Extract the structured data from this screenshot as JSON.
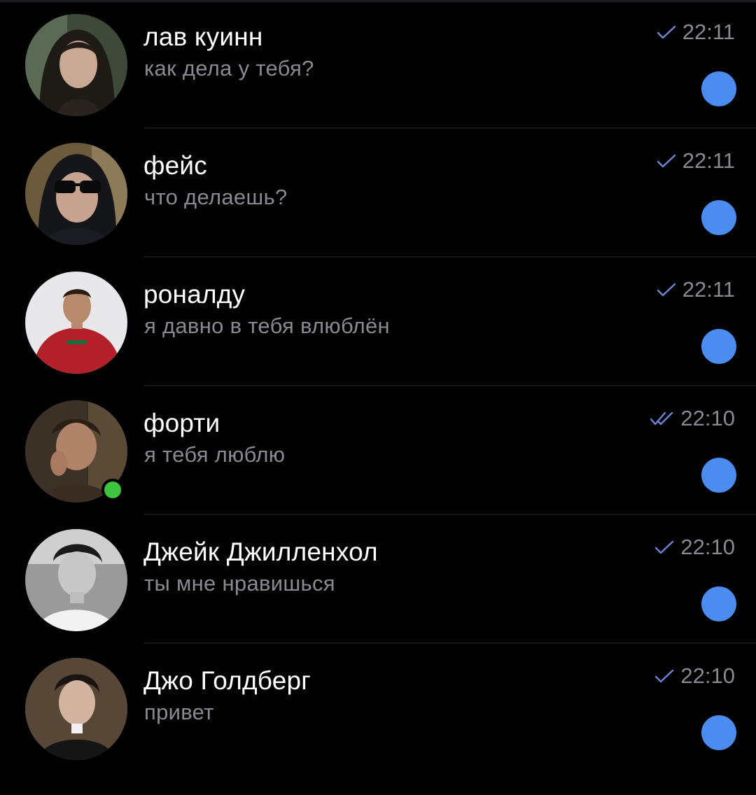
{
  "colors": {
    "background": "#000000",
    "name_text": "#ffffff",
    "secondary_text": "#8a8a8e",
    "read_check": "#6f86d6",
    "unread_dot": "#4a8cf0",
    "online_dot": "#3ec43e"
  },
  "chats": [
    {
      "name": "лав куинн",
      "preview": "как дела у тебя?",
      "time": "22:11",
      "status_icon": "single-check-icon",
      "unread": true,
      "online": false,
      "avatar_icon": "avatar-photo-woman"
    },
    {
      "name": "фейс",
      "preview": "что делаешь?",
      "time": "22:11",
      "status_icon": "single-check-icon",
      "unread": true,
      "online": false,
      "avatar_icon": "avatar-photo-sunglasses"
    },
    {
      "name": "роналду",
      "preview": "я давно в тебя влюблён",
      "time": "22:11",
      "status_icon": "single-check-icon",
      "unread": true,
      "online": false,
      "avatar_icon": "avatar-photo-football-player"
    },
    {
      "name": "форти",
      "preview": "я тебя люблю",
      "time": "22:10",
      "status_icon": "double-check-icon",
      "unread": true,
      "online": true,
      "avatar_icon": "avatar-photo-man"
    },
    {
      "name": "Джейк Джилленхол",
      "preview": "ты мне нравишься",
      "time": "22:10",
      "status_icon": "single-check-icon",
      "unread": true,
      "online": false,
      "avatar_icon": "avatar-photo-man-bw"
    },
    {
      "name": "Джо Голдберг",
      "preview": "привет",
      "time": "22:10",
      "status_icon": "single-check-icon",
      "unread": true,
      "online": false,
      "avatar_icon": "avatar-photo-man-dark-hair"
    }
  ]
}
